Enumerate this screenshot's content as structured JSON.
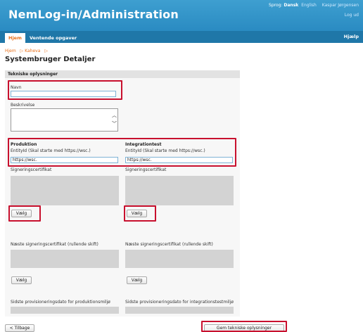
{
  "header": {
    "app_title": "NemLog-in/Administration",
    "language_label": "Sprog:",
    "language_active": "Dansk",
    "language_alt": "English",
    "user_name": "Kaspar Jørgensen",
    "logout": "Log ud"
  },
  "nav": {
    "tabs": [
      {
        "label": "Hjem",
        "active": true
      },
      {
        "label": "Ventende opgaver",
        "active": false
      }
    ],
    "help": "Hjælp"
  },
  "breadcrumb": [
    "Hjem",
    "▷ Kaheva",
    "▷"
  ],
  "page_title": "Systembruger Detaljer",
  "panel_title": "Tekniske oplysninger",
  "form": {
    "name_label": "Navn",
    "name_value": "",
    "description_label": "Beskrivelse",
    "production": {
      "heading": "Produktion",
      "entity_label": "EntityId (Skal starte med https://wsc.)",
      "entity_value": "https://wsc.",
      "cert_label": "Signeringscertifikat",
      "choose": "Vælg",
      "next_cert_label": "Næste signeringscertifikat (rullende skift)",
      "choose_next": "Vælg",
      "provision_label": "Sidste provisioneringsdato for produktionsmiljø"
    },
    "integration": {
      "heading": "Integrationtest",
      "entity_label": "EntityId (Skal starte med https://wsc.)",
      "entity_value": "https://wsc.",
      "cert_label": "Signeringscertifikat",
      "choose": "Vælg",
      "next_cert_label": "Næste signeringscertifikat (rullende skift)",
      "choose_next": "Vælg",
      "provision_label": "Sidste provisioneringsdato for integrationstestmiljø"
    }
  },
  "footer": {
    "back": "< Tilbage",
    "save": "Gem tekniske oplysninger"
  },
  "colors": {
    "header_bg": "#2a8bc2",
    "nav_bg": "#1f77a8",
    "accent_orange": "#e8701a",
    "highlight_red": "#c8102e"
  }
}
